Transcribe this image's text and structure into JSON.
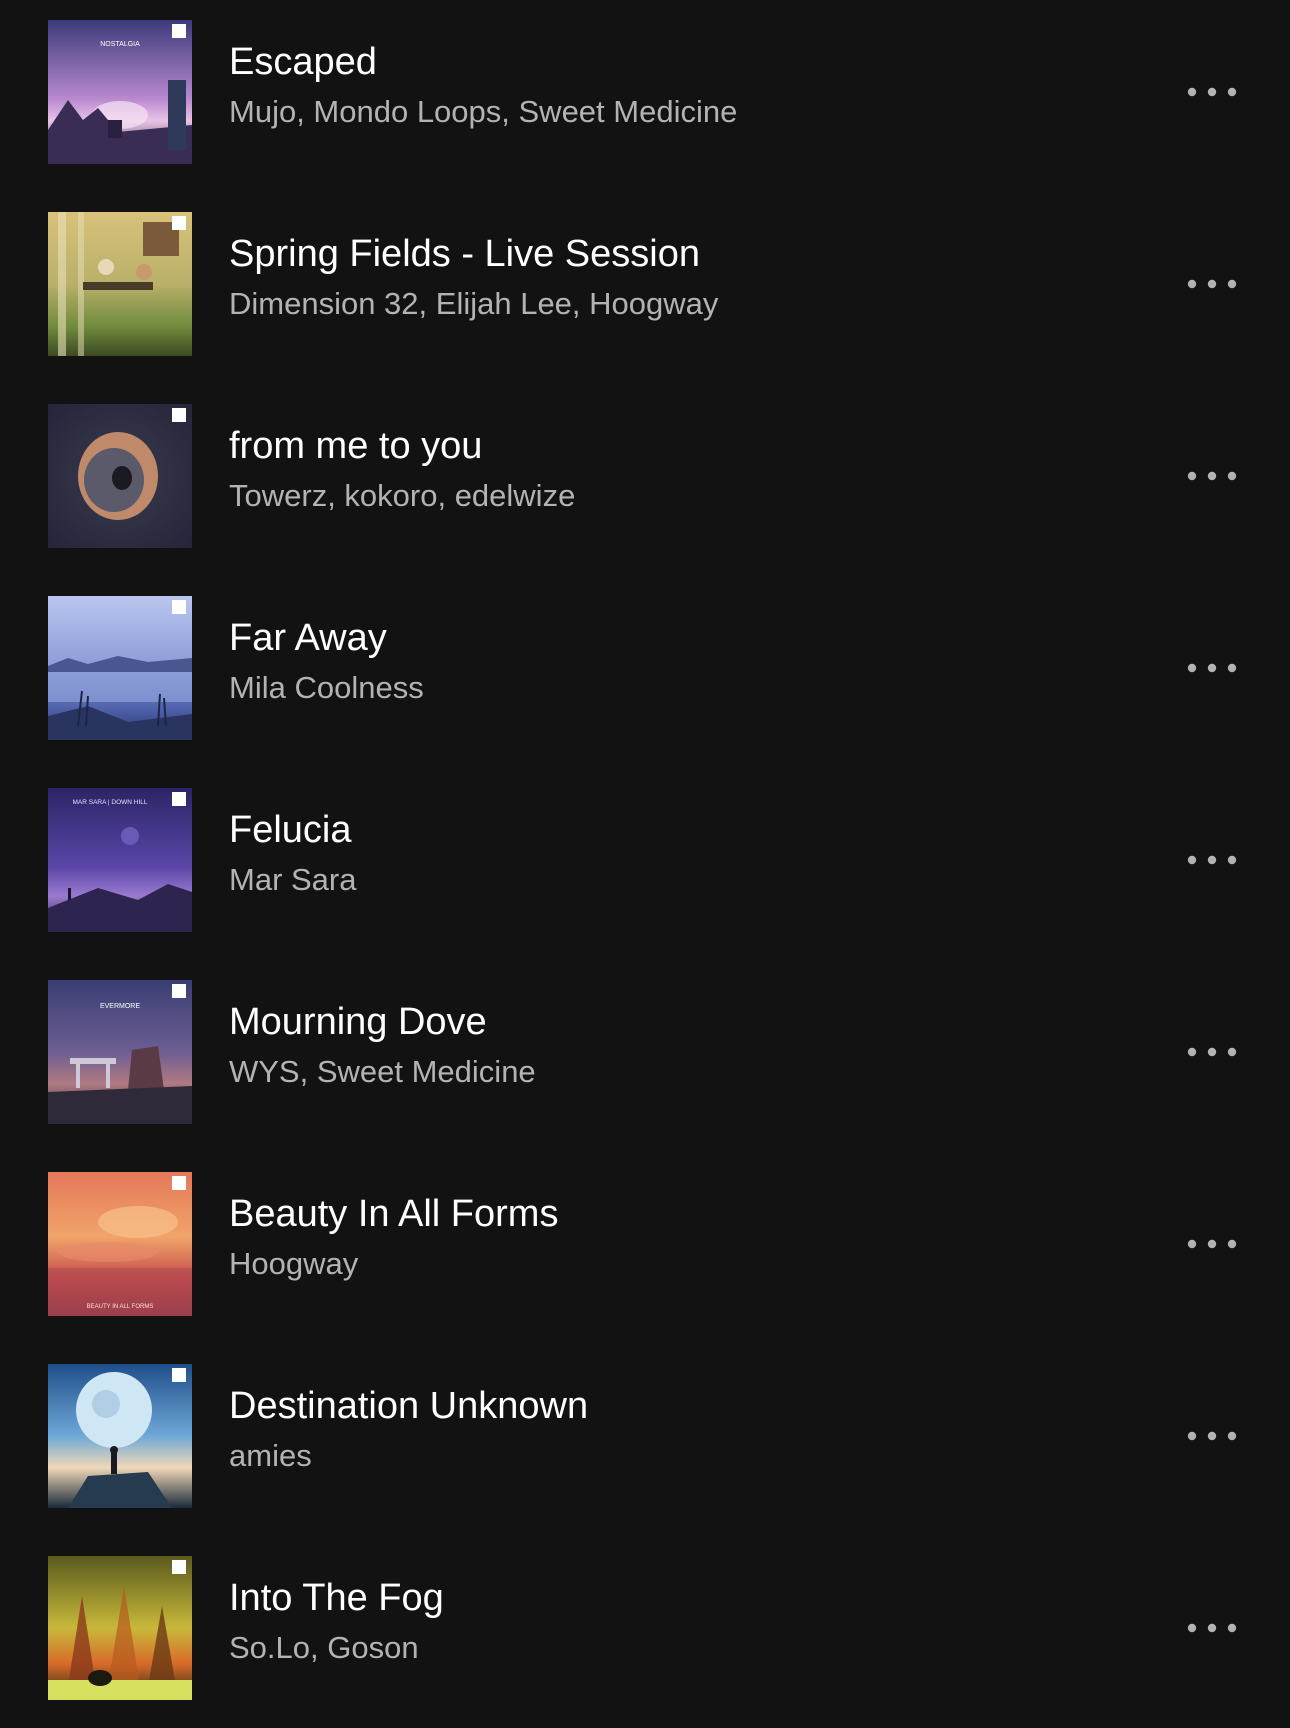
{
  "tracks": [
    {
      "title": "Escaped",
      "artists": "Mujo, Mondo Loops, Sweet Medicine",
      "cover_text": "NOSTALGIA",
      "cover_colors": [
        "#3b3a7a",
        "#b98ad0",
        "#e9c3e6",
        "#2a2244"
      ]
    },
    {
      "title": "Spring Fields - Live Session",
      "artists": "Dimension 32, Elijah Lee, Hoogway",
      "cover_text": "",
      "cover_colors": [
        "#d8c27a",
        "#b9b06a",
        "#6f8a3c",
        "#3d4a22"
      ]
    },
    {
      "title": "from me to you",
      "artists": "Towerz, kokoro, edelwize",
      "cover_text": "",
      "cover_colors": [
        "#3a3b4e",
        "#2c2d3d",
        "#c08a6a",
        "#6a4a3a"
      ]
    },
    {
      "title": "Far Away",
      "artists": "Mila Coolness",
      "cover_text": "",
      "cover_colors": [
        "#b9c6ee",
        "#8c9bd8",
        "#4c5ea8",
        "#27325a"
      ]
    },
    {
      "title": "Felucia",
      "artists": "Mar Sara",
      "cover_text": "MAR SARA | DOWN HILL",
      "cover_colors": [
        "#2a2566",
        "#5a46a8",
        "#9a7ad0",
        "#231a3a"
      ]
    },
    {
      "title": "Mourning Dove",
      "artists": "WYS, Sweet Medicine",
      "cover_text": "EVERMORE",
      "cover_colors": [
        "#3a3e74",
        "#6c5e92",
        "#b07a82",
        "#2a2432"
      ]
    },
    {
      "title": "Beauty In All Forms",
      "artists": "Hoogway",
      "cover_text": "BEAUTY IN ALL FORMS",
      "cover_colors": [
        "#e3785a",
        "#f2a46a",
        "#c24a4a",
        "#7a3046"
      ]
    },
    {
      "title": "Destination Unknown",
      "artists": "amies",
      "cover_text": "",
      "cover_colors": [
        "#1e4e8a",
        "#6fa8d8",
        "#f0d8b8",
        "#1a2a3a"
      ]
    },
    {
      "title": "Into The Fog",
      "artists": "So.Lo, Goson",
      "cover_text": "",
      "cover_colors": [
        "#5a5a1e",
        "#c8b83a",
        "#d86a2a",
        "#1e2a12"
      ]
    }
  ],
  "more_icon": "more-horizontal-icon",
  "colors": {
    "background": "#121212",
    "title_text": "#ffffff",
    "artist_text": "#b3b3b3",
    "icon": "#b3b3b3"
  }
}
